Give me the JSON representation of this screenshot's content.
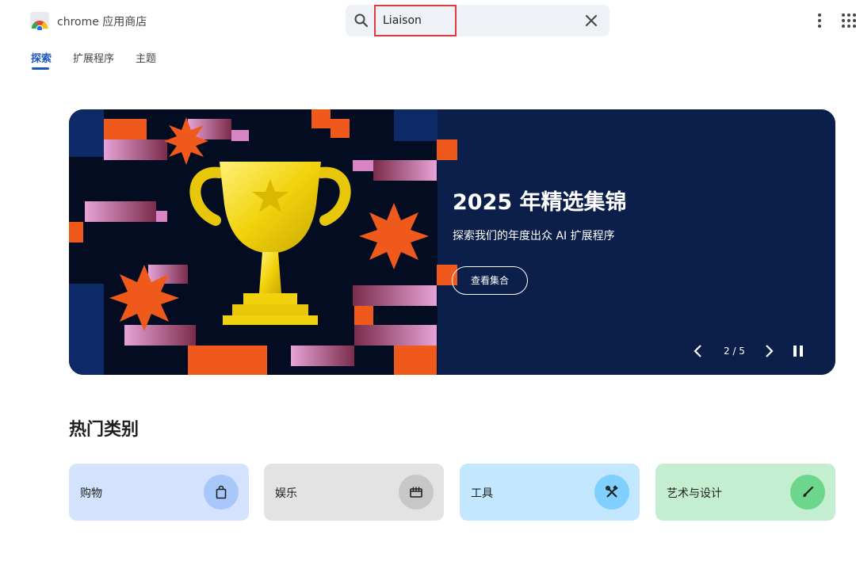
{
  "header": {
    "brand": "chrome 应用商店",
    "search": {
      "query": "Liaison"
    }
  },
  "tabs": [
    {
      "label": "探索",
      "active": true
    },
    {
      "label": "扩展程序",
      "active": false
    },
    {
      "label": "主题",
      "active": false
    }
  ],
  "hero": {
    "title": "2025 年精选集锦",
    "subtitle": "探索我们的年度出众 AI 扩展程序",
    "button": "查看集合",
    "counter": "2 / 5"
  },
  "categories_section": {
    "title": "热门类别",
    "items": [
      {
        "label": "购物",
        "icon": "shopping-bag-icon",
        "bg": "#d3e3fd",
        "circle": "#a8c7fa"
      },
      {
        "label": "娱乐",
        "icon": "film-icon",
        "bg": "#e3e3e3",
        "circle": "#c7c7c7"
      },
      {
        "label": "工具",
        "icon": "tools-icon",
        "bg": "#c2e7ff",
        "circle": "#7fcfff"
      },
      {
        "label": "艺术与设计",
        "icon": "brush-icon",
        "bg": "#c4eed0",
        "circle": "#6dd58c"
      }
    ]
  },
  "colors": {
    "accent": "#1a56c2",
    "hero_bg": "#0b1f4a",
    "search_highlight": "#e0393e"
  }
}
